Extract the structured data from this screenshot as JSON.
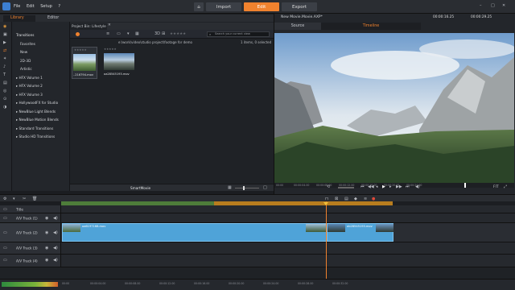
{
  "app": {
    "menu": [
      "File",
      "Edit",
      "Setup"
    ],
    "tabs": {
      "import": "Import",
      "edit": "Edit",
      "export": "Export"
    },
    "accent": "#f0822e"
  },
  "library": {
    "tabs": {
      "library": "Library",
      "editor": "Editor"
    },
    "project_bin_tab": "Project Bin: Lifestyle",
    "path": "e:\\work\\video\\studio project\\footage for demo",
    "search_placeholder": "Search your current view",
    "selection_status": "1 items, 0 selected",
    "smartmovie": "SmartMovie",
    "section_title": "Transitions"
  },
  "sidebar": {
    "items": [
      "Favorites",
      "New",
      "2D-3D",
      "Artistic",
      "HFX Volume 1",
      "HFX Volume 2",
      "HFX Volume 3",
      "HollywoodFX for Studio",
      "NewBlue Light Blends",
      "NewBlue Motion Blends",
      "Standard Transitions",
      "Studio HD Transitions"
    ]
  },
  "media": [
    {
      "name": "..216794.mov",
      "rating": "★★★★★"
    },
    {
      "name": "oa28545193.mov",
      "rating": "★★★★★"
    }
  ],
  "preview": {
    "title": "New Movie.Movie.AXP*",
    "timecode_left": "00:00:16.25",
    "timecode_right": "00:00:29.25",
    "tabs": {
      "source": "Source",
      "timeline": "Timeline"
    },
    "ruler": [
      "00:00",
      "00:00:04.00",
      "00:00:08.00",
      "00:00:12.00",
      "00:00:16.00",
      "00:00:20.00",
      "00:00:24.00"
    ],
    "zoom": "FIT"
  },
  "timeline": {
    "tracks": [
      {
        "name": "Title"
      },
      {
        "name": "A/V Track (1)"
      },
      {
        "name": "A/V Track (2)"
      },
      {
        "name": "A/V Track (3)"
      },
      {
        "name": "A/V Track (4)"
      }
    ],
    "clips": [
      {
        "name": "oa6197168.mov"
      },
      {
        "name": "ob28545193.mov"
      }
    ],
    "ruler": [
      "00:00",
      "00:00:04.00",
      "00:00:08.00",
      "00:00:12.00",
      "00:00:16.00",
      "00:00:20.00",
      "00:00:24.00",
      "00:00:28.00",
      "00:00:32.00"
    ]
  }
}
